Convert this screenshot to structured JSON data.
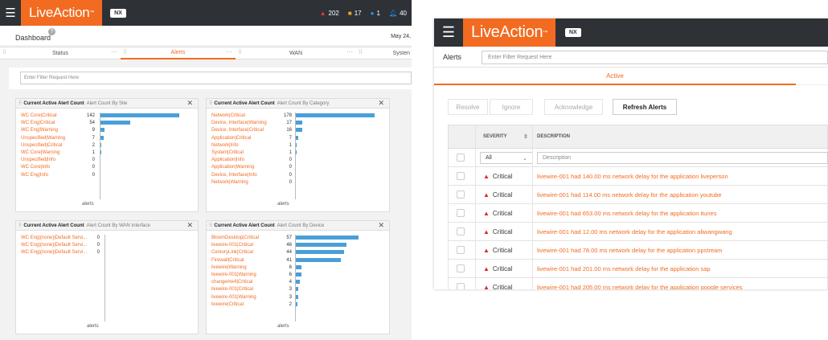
{
  "left": {
    "topbar": {
      "menu_icon": "hamburger-icon",
      "brand": "LiveAction",
      "brand_mark": "™",
      "product": "NX",
      "stats": [
        {
          "icon": "triangle-alert-icon",
          "color": "#e53935",
          "value": "202"
        },
        {
          "icon": "square-warning-icon",
          "color": "#f5a623",
          "value": "17"
        },
        {
          "icon": "circle-info-icon",
          "color": "#2196f3",
          "value": "1"
        },
        {
          "icon": "bell-icon",
          "color": "#2196f3",
          "value": "40"
        }
      ]
    },
    "dashboard": {
      "title": "Dashboard",
      "help": "?",
      "date": "May 24,"
    },
    "tabs": [
      {
        "label": "Status",
        "more": "···"
      },
      {
        "label": "Alerts",
        "more": "···"
      },
      {
        "label": "WAN",
        "more": "···"
      },
      {
        "label": "Systen",
        "more": ""
      }
    ],
    "filter_placeholder": "Enter Filter Request Here",
    "panels": [
      {
        "title": "Current Active Alert Count",
        "subtitle": "Alert Count By Site",
        "legend": "alerts",
        "rows": [
          {
            "label": "WC Core|Critical",
            "value": 142
          },
          {
            "label": "WC Eng|Critical",
            "value": 54
          },
          {
            "label": "WC Eng|Warning",
            "value": 9
          },
          {
            "label": "Unspecified|Warning",
            "value": 7
          },
          {
            "label": "Unspecified|Critical",
            "value": 2
          },
          {
            "label": "WC Core|Warning",
            "value": 1
          },
          {
            "label": "Unspecified|Info",
            "value": 0
          },
          {
            "label": "WC Core|Info",
            "value": 0
          },
          {
            "label": "WC Eng|Info",
            "value": 0
          }
        ]
      },
      {
        "title": "Current Active Alert Count",
        "subtitle": "Alert Count By Category",
        "legend": "alerts",
        "rows": [
          {
            "label": "Network|Critical",
            "value": 178
          },
          {
            "label": "Device, Interface|Warning",
            "value": 17
          },
          {
            "label": "Device, Interface|Critical",
            "value": 16
          },
          {
            "label": "Application|Critical",
            "value": 7
          },
          {
            "label": "Network|Info",
            "value": 1
          },
          {
            "label": "System|Critical",
            "value": 1
          },
          {
            "label": "Application|Info",
            "value": 0
          },
          {
            "label": "Application|Warning",
            "value": 0
          },
          {
            "label": "Device, Interface|Info",
            "value": 0
          },
          {
            "label": "Network|Warning",
            "value": 0
          }
        ]
      },
      {
        "title": "Current Active Alert Count",
        "subtitle": "Alert Count By WAN Interface",
        "legend": "alerts",
        "rows": [
          {
            "label": "WC Eng|(none)|Default Servi...",
            "value": 0
          },
          {
            "label": "WC Eng|(none)|Default Servi...",
            "value": 0
          },
          {
            "label": "WC Eng|(none)|Default Servi...",
            "value": 0
          }
        ]
      },
      {
        "title": "Current Active Alert Count",
        "subtitle": "Alert Count By Device",
        "legend": "alerts",
        "rows": [
          {
            "label": "BloomDesktop|Critical",
            "value": 57
          },
          {
            "label": "livewire-001|Critical",
            "value": 46
          },
          {
            "label": "CenturyLink|Critical",
            "value": 44
          },
          {
            "label": "Firewall|Critical",
            "value": 41
          },
          {
            "label": "livewire|Warning",
            "value": 6
          },
          {
            "label": "livewire-001|Warning",
            "value": 6
          },
          {
            "label": "changeme4|Critical",
            "value": 4
          },
          {
            "label": "livewire-001|Critical",
            "value": 3
          },
          {
            "label": "livewire-001|Warning",
            "value": 3
          },
          {
            "label": "livewire|Critical",
            "value": 2
          }
        ]
      }
    ]
  },
  "right": {
    "topbar": {
      "menu_icon": "hamburger-icon",
      "brand": "LiveAction",
      "brand_mark": "™",
      "product": "NX"
    },
    "page_label": "Alerts",
    "filter_placeholder": "Enter Filter Request Here",
    "tabs": [
      {
        "label": "Active"
      }
    ],
    "buttons": [
      {
        "label": "Resolve",
        "enabled": false
      },
      {
        "label": "Ignore",
        "enabled": false
      },
      {
        "label": "Acknowledge",
        "enabled": false
      },
      {
        "label": "Refresh Alerts",
        "enabled": true
      }
    ],
    "table": {
      "columns": {
        "severity": "SEVERITY",
        "description": "DESCRIPTION"
      },
      "severity_filter": "All",
      "description_placeholder": "Description",
      "rows": [
        {
          "severity": "Critical",
          "description": "livewire-001 had 140.00 ms network delay for the application liveperson"
        },
        {
          "severity": "Critical",
          "description": "livewire-001 had 114.00 ms network delay for the application youtube"
        },
        {
          "severity": "Critical",
          "description": "livewire-001 had 653.00 ms network delay for the application itunes"
        },
        {
          "severity": "Critical",
          "description": "livewire-001 had 12.00 ms network delay for the application aliwangwang"
        },
        {
          "severity": "Critical",
          "description": "livewire-001 had 78.00 ms network delay for the application ppstream"
        },
        {
          "severity": "Critical",
          "description": "livewire-001 had 201.00 ms network delay for the application sap"
        },
        {
          "severity": "Critical",
          "description": "livewire-001 had 205.00 ms network delay for the application google services"
        }
      ]
    }
  }
}
